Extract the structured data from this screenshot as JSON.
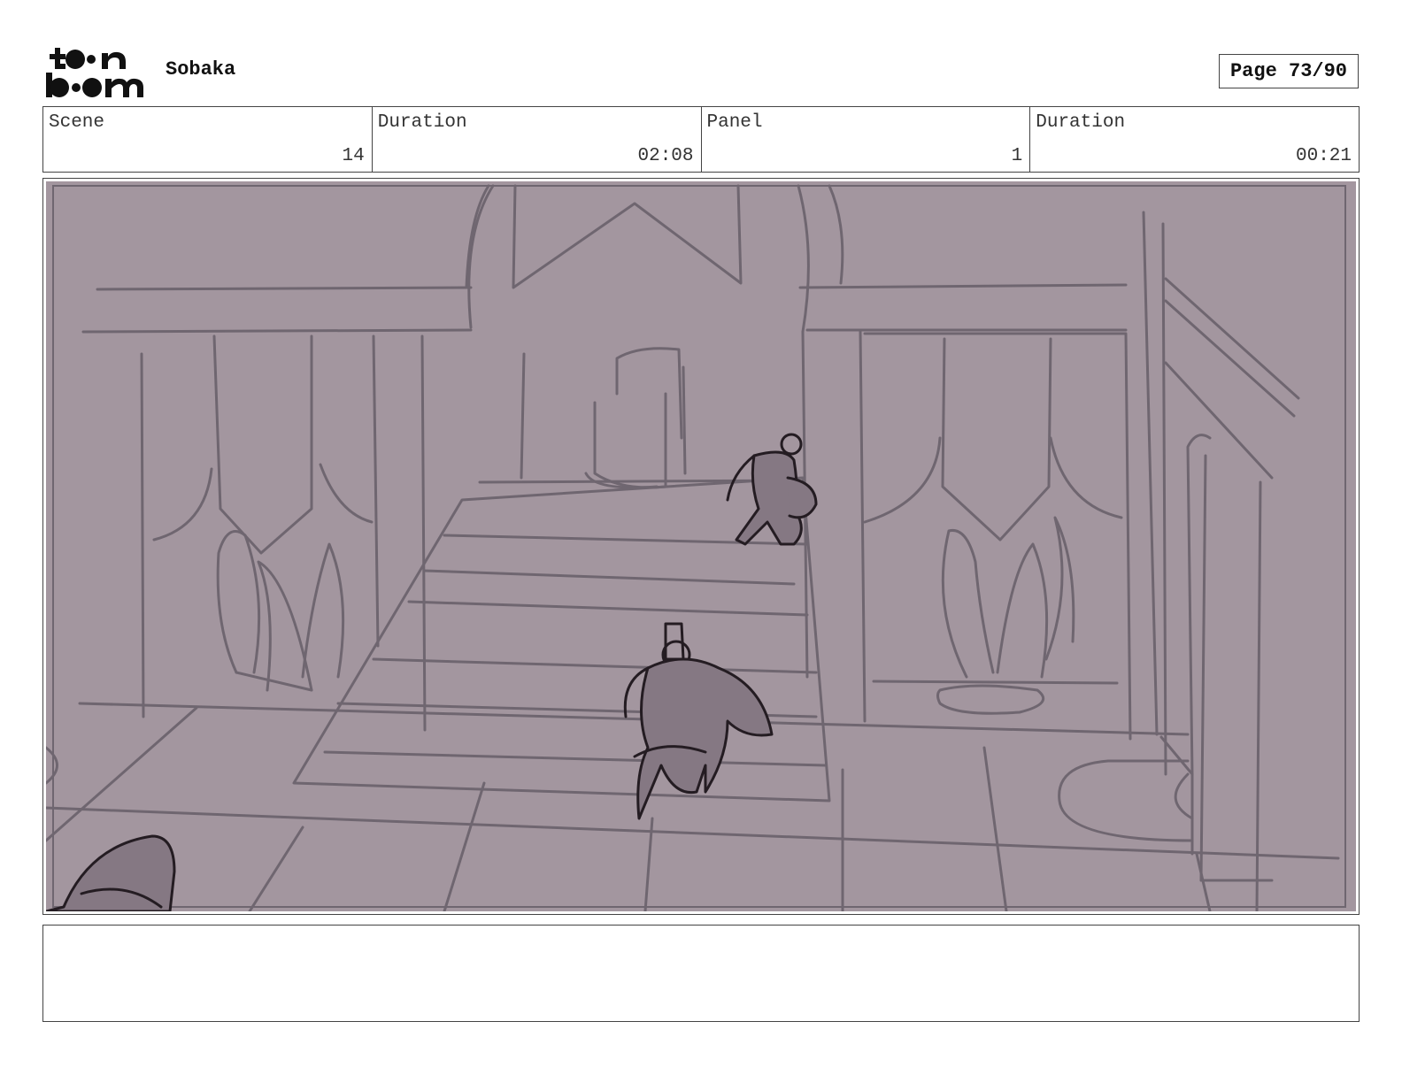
{
  "header": {
    "logo_text": "toonboom",
    "project_title": "Sobaka",
    "page_label": "Page 73/90"
  },
  "info": [
    {
      "label": "Scene",
      "value": "14"
    },
    {
      "label": "Duration",
      "value": "02:08"
    },
    {
      "label": "Panel",
      "value": "1"
    },
    {
      "label": "Duration",
      "value": "00:21"
    }
  ],
  "panel": {
    "background_color": "#a3969f",
    "line_color": "#6f6670",
    "figure_line_color": "#241c22",
    "figure_fill_color": "#857883"
  },
  "notes": {
    "text": ""
  }
}
